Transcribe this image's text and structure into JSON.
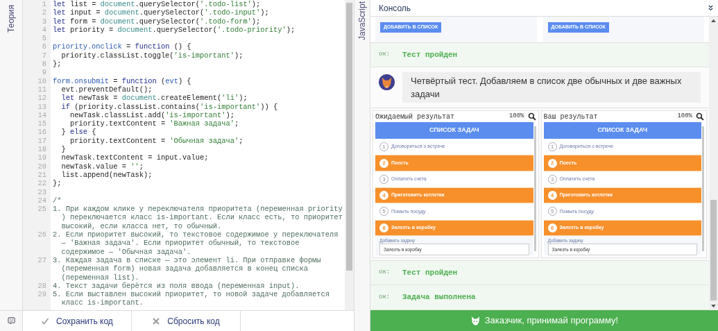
{
  "side_tabs": {
    "left": "Теория",
    "right": "JavaScript"
  },
  "editor": {
    "lines": [
      {
        "number": "1",
        "tokens": [
          {
            "text": "let",
            "kind": "kw"
          },
          {
            "text": " list = ",
            "kind": "plain"
          },
          {
            "text": "document",
            "kind": "obj"
          },
          {
            "text": ".querySelector(",
            "kind": "plain"
          },
          {
            "text": "'.todo-list'",
            "kind": "str"
          },
          {
            "text": ");",
            "kind": "plain"
          }
        ]
      },
      {
        "number": "2",
        "tokens": [
          {
            "text": "let",
            "kind": "kw"
          },
          {
            "text": " input = ",
            "kind": "plain"
          },
          {
            "text": "document",
            "kind": "obj"
          },
          {
            "text": ".querySelector(",
            "kind": "plain"
          },
          {
            "text": "'.todo-input'",
            "kind": "str"
          },
          {
            "text": ");",
            "kind": "plain"
          }
        ]
      },
      {
        "number": "3",
        "tokens": [
          {
            "text": "let",
            "kind": "kw"
          },
          {
            "text": " form = ",
            "kind": "plain"
          },
          {
            "text": "document",
            "kind": "obj"
          },
          {
            "text": ".querySelector(",
            "kind": "plain"
          },
          {
            "text": "'.todo-form'",
            "kind": "str"
          },
          {
            "text": ");",
            "kind": "plain"
          }
        ]
      },
      {
        "number": "4",
        "tokens": [
          {
            "text": "let",
            "kind": "kw"
          },
          {
            "text": " priority = ",
            "kind": "plain"
          },
          {
            "text": "document",
            "kind": "obj"
          },
          {
            "text": ".querySelector(",
            "kind": "plain"
          },
          {
            "text": "'.todo-priority'",
            "kind": "str"
          },
          {
            "text": ");",
            "kind": "plain"
          }
        ]
      },
      {
        "number": "5"
      },
      {
        "number": "6",
        "tokens": [
          {
            "text": "priority.onclick",
            "kind": "def"
          },
          {
            "text": " = ",
            "kind": "plain"
          },
          {
            "text": "function",
            "kind": "kw"
          },
          {
            "text": " () {",
            "kind": "plain"
          }
        ]
      },
      {
        "number": "7",
        "tokens": [
          {
            "text": "  priority.classList.toggle(",
            "kind": "plain"
          },
          {
            "text": "'is-important'",
            "kind": "str"
          },
          {
            "text": ");",
            "kind": "plain"
          }
        ]
      },
      {
        "number": "8",
        "tokens": [
          {
            "text": "};",
            "kind": "plain"
          }
        ]
      },
      {
        "number": "9"
      },
      {
        "number": "10",
        "tokens": [
          {
            "text": "form.onsubmit",
            "kind": "def"
          },
          {
            "text": " = ",
            "kind": "plain"
          },
          {
            "text": "function",
            "kind": "kw"
          },
          {
            "text": " (",
            "kind": "plain"
          },
          {
            "text": "evt",
            "kind": "def"
          },
          {
            "text": ") {",
            "kind": "plain"
          }
        ]
      },
      {
        "number": "11",
        "tokens": [
          {
            "text": "  evt.preventDefault();",
            "kind": "plain"
          }
        ]
      },
      {
        "number": "12",
        "tokens": [
          {
            "text": "  let",
            "kind": "kw"
          },
          {
            "text": " newTask = ",
            "kind": "plain"
          },
          {
            "text": "document",
            "kind": "obj"
          },
          {
            "text": ".createElement(",
            "kind": "plain"
          },
          {
            "text": "'li'",
            "kind": "str"
          },
          {
            "text": ");",
            "kind": "plain"
          }
        ]
      },
      {
        "number": "13",
        "tokens": [
          {
            "text": "  if",
            "kind": "kw"
          },
          {
            "text": " (priority.classList.contains(",
            "kind": "plain"
          },
          {
            "text": "'is-important'",
            "kind": "str"
          },
          {
            "text": ")) {",
            "kind": "plain"
          }
        ]
      },
      {
        "number": "14",
        "tokens": [
          {
            "text": "    newTask.classList.add(",
            "kind": "plain"
          },
          {
            "text": "'is-important'",
            "kind": "str"
          },
          {
            "text": ");",
            "kind": "plain"
          }
        ]
      },
      {
        "number": "15",
        "tokens": [
          {
            "text": "    priority.textContent = ",
            "kind": "plain"
          },
          {
            "text": "'Важная задача'",
            "kind": "str"
          },
          {
            "text": ";",
            "kind": "plain"
          }
        ]
      },
      {
        "number": "16",
        "tokens": [
          {
            "text": "  } ",
            "kind": "plain"
          },
          {
            "text": "else",
            "kind": "kw"
          },
          {
            "text": " {",
            "kind": "plain"
          }
        ]
      },
      {
        "number": "17",
        "tokens": [
          {
            "text": "    priority.textContent = ",
            "kind": "plain"
          },
          {
            "text": "'Обычная задача'",
            "kind": "str"
          },
          {
            "text": ";",
            "kind": "plain"
          }
        ]
      },
      {
        "number": "18",
        "tokens": [
          {
            "text": "  }",
            "kind": "plain"
          }
        ]
      },
      {
        "number": "19",
        "tokens": [
          {
            "text": "  newTask.textContent = input.value;",
            "kind": "plain"
          }
        ]
      },
      {
        "number": "20",
        "tokens": [
          {
            "text": "  newTask.value = ",
            "kind": "plain"
          },
          {
            "text": "''",
            "kind": "str"
          },
          {
            "text": ";",
            "kind": "plain"
          }
        ]
      },
      {
        "number": "21",
        "tokens": [
          {
            "text": "  list.append(newTask);",
            "kind": "plain"
          }
        ]
      },
      {
        "number": "22",
        "tokens": [
          {
            "text": "};",
            "kind": "plain"
          }
        ]
      },
      {
        "number": "23"
      },
      {
        "number": "24",
        "tokens": [
          {
            "text": "/*",
            "kind": "comment"
          }
        ]
      },
      {
        "number": "25",
        "tokens": [
          {
            "text": "1. При каждом клике у переключателя приоритета (переменная priority ) переключается класс is-important. Если класс есть, то приоритет высокий, если класса нет, то обычный.",
            "kind": "comment"
          }
        ]
      },
      {
        "number": "26",
        "tokens": [
          {
            "text": "2. Если приоритет высокий, то текстовое содержимое у переключателя — 'Важная задача'. Если приоритет обычный, то текстовое содержимое — 'Обычная задача'.",
            "kind": "comment"
          }
        ]
      },
      {
        "number": "27",
        "tokens": [
          {
            "text": "3. Каждая задача в списке — это элемент li. При отправке формы (переменная form) новая задача добавляется в конец списка (переменная list).",
            "kind": "comment"
          }
        ]
      },
      {
        "number": "28",
        "tokens": [
          {
            "text": "4. Текст задачи берётся из поля ввода (переменная input).",
            "kind": "comment"
          }
        ]
      },
      {
        "number": "29",
        "tokens": [
          {
            "text": "5. Если выставлен высокий приоритет, то новой задаче добавляется класс is-important.",
            "kind": "comment"
          }
        ]
      }
    ]
  },
  "toolbar": {
    "buttons": [
      {
        "label": "Сохранить код",
        "kind": "save"
      },
      {
        "label": "Сбросить код",
        "kind": "reset"
      }
    ]
  },
  "console": {
    "title": "Консоль",
    "add_buttons": [
      "ДОБАВИТЬ В СПИСОК",
      "ДОБАВИТЬ В СПИСОК"
    ],
    "entries": [
      {
        "kind": "ok",
        "prefix": "ок:",
        "text": "Тест пройден"
      },
      {
        "kind": "message",
        "text": "Четвёртый тест. Добавляем в список две обычных и две важных задачи"
      },
      {
        "kind": "results",
        "panels": [
          {
            "title": "Ожидаемый результат",
            "zoom": "100%",
            "list_title": "СПИСОК ЗАДАЧ",
            "input_label": "Добавить задачу",
            "input_value": "Залезть в коробку",
            "items": [
              {
                "number": "1",
                "text": "Договориться о встрече",
                "important": false
              },
              {
                "number": "2",
                "text": "Поесть",
                "important": true
              },
              {
                "number": "3",
                "text": "Оплатить счета",
                "important": false
              },
              {
                "number": "4",
                "text": "Приготовить котлетки",
                "important": true
              },
              {
                "number": "5",
                "text": "Помыть посуду",
                "important": false
              },
              {
                "number": "6",
                "text": "Залезть в коробку",
                "important": true
              }
            ]
          },
          {
            "title": "Ваш результат",
            "zoom": "100%",
            "list_title": "СПИСОК ЗАДАЧ",
            "input_label": "Добавить задачу",
            "input_value": "Залезть в коробку",
            "items": [
              {
                "number": "1",
                "text": "Договориться о встрече",
                "important": false
              },
              {
                "number": "2",
                "text": "Поесть",
                "important": true
              },
              {
                "number": "3",
                "text": "Оплатить счета",
                "important": false
              },
              {
                "number": "4",
                "text": "Приготовить котлетки",
                "important": true
              },
              {
                "number": "5",
                "text": "Помыть посуду",
                "important": false
              },
              {
                "number": "6",
                "text": "Залезть в коробку",
                "important": true
              }
            ]
          }
        ]
      },
      {
        "kind": "ok",
        "prefix": "ок:",
        "text": "Тест пройден"
      },
      {
        "kind": "ok",
        "prefix": "ок:",
        "text": "Задача выполнена"
      }
    ]
  },
  "submit_button": "Заказчик, принимай программу!"
}
